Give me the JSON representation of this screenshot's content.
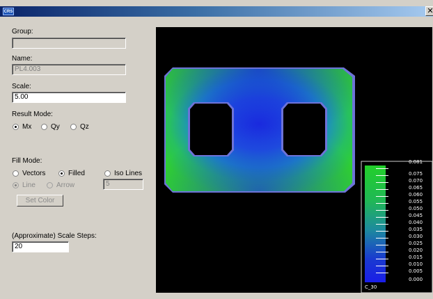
{
  "titlebar": {
    "app_icon_label": "CRS",
    "close_label": "✕"
  },
  "panel": {
    "group_label": "Group:",
    "group_value": "",
    "name_label": "Name:",
    "name_value": "PL4.003",
    "scale_label": "Scale:",
    "scale_value": "5.00",
    "result_mode_label": "Result Mode:",
    "result_modes": [
      {
        "label": "Mx",
        "checked": true
      },
      {
        "label": "Qy",
        "checked": false
      },
      {
        "label": "Qz",
        "checked": false
      }
    ],
    "fill_mode_label": "Fill Mode:",
    "fill_modes": [
      {
        "label": "Vectors",
        "checked": false
      },
      {
        "label": "Filled",
        "checked": true
      },
      {
        "label": "Iso Lines",
        "checked": false
      }
    ],
    "vector_types": [
      {
        "label": "Line",
        "checked": true
      },
      {
        "label": "Arrow",
        "checked": false
      }
    ],
    "iso_lines_value": "5",
    "set_color_label": "Set Color",
    "scale_steps_label": "(Approximate) Scale Steps:",
    "scale_steps_value": "20"
  },
  "legend": {
    "values": [
      "0.081",
      "0.075",
      "0.070",
      "0.065",
      "0.060",
      "0.055",
      "0.050",
      "0.045",
      "0.040",
      "0.035",
      "0.030",
      "0.025",
      "0.020",
      "0.015",
      "0.010",
      "0.005",
      "0.000"
    ],
    "bottom_label": "C_30"
  },
  "colors": {
    "titlebar_start": "#0a246a",
    "plate_green": "#2fd12f",
    "plate_blue": "#1a28e0",
    "plate_edge": "#6d73d8",
    "viewport_bg": "#000000"
  }
}
